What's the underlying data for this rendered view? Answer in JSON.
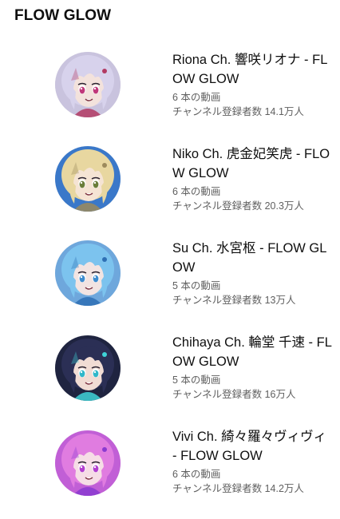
{
  "section": {
    "title": "FLOW GLOW"
  },
  "channels": [
    {
      "name": "Riona Ch. 響咲リオナ - FLOW GLOW",
      "video_count": "6 本の動画",
      "subscribers": "チャンネル登録者数 14.1万人",
      "colors": {
        "bg": "#c9c3de",
        "hair": "#d7d2ec",
        "accent": "#b23a63",
        "skin": "#f3e2dc",
        "eye": "#c0387a"
      }
    },
    {
      "name": "Niko Ch. 虎金妃笑虎 - FLOW GLOW",
      "video_count": "6 本の動画",
      "subscribers": "チャンネル登録者数 20.3万人",
      "colors": {
        "bg": "#3a78c9",
        "hair": "#e8d7a0",
        "accent": "#9c8a5c",
        "skin": "#f5e4d4",
        "eye": "#6a7d3a"
      }
    },
    {
      "name": "Su Ch. 水宮枢 - FLOW GLOW",
      "video_count": "5 本の動画",
      "subscribers": "チャンネル登録者数 13万人",
      "colors": {
        "bg": "#6ea7dc",
        "hair": "#7cc3ee",
        "accent": "#2e6fb4",
        "skin": "#f2e4e2",
        "eye": "#3d8ccf"
      }
    },
    {
      "name": "Chihaya Ch. 輪堂 千速 - FLOW GLOW",
      "video_count": "5 本の動画",
      "subscribers": "チャンネル登録者数 16万人",
      "colors": {
        "bg": "#1f2440",
        "hair": "#2b2f55",
        "accent": "#3fd3d8",
        "skin": "#f1dcd4",
        "eye": "#2fb7c9"
      }
    },
    {
      "name": "Vivi Ch. 綺々羅々ヴィヴィ - FLOW GLOW",
      "video_count": "6 本の動画",
      "subscribers": "チャンネル登録者数 14.2万人",
      "colors": {
        "bg": "#c15fd6",
        "hair": "#e07ce0",
        "accent": "#8a3ad0",
        "skin": "#f6dde6",
        "eye": "#b23fcf"
      }
    }
  ]
}
